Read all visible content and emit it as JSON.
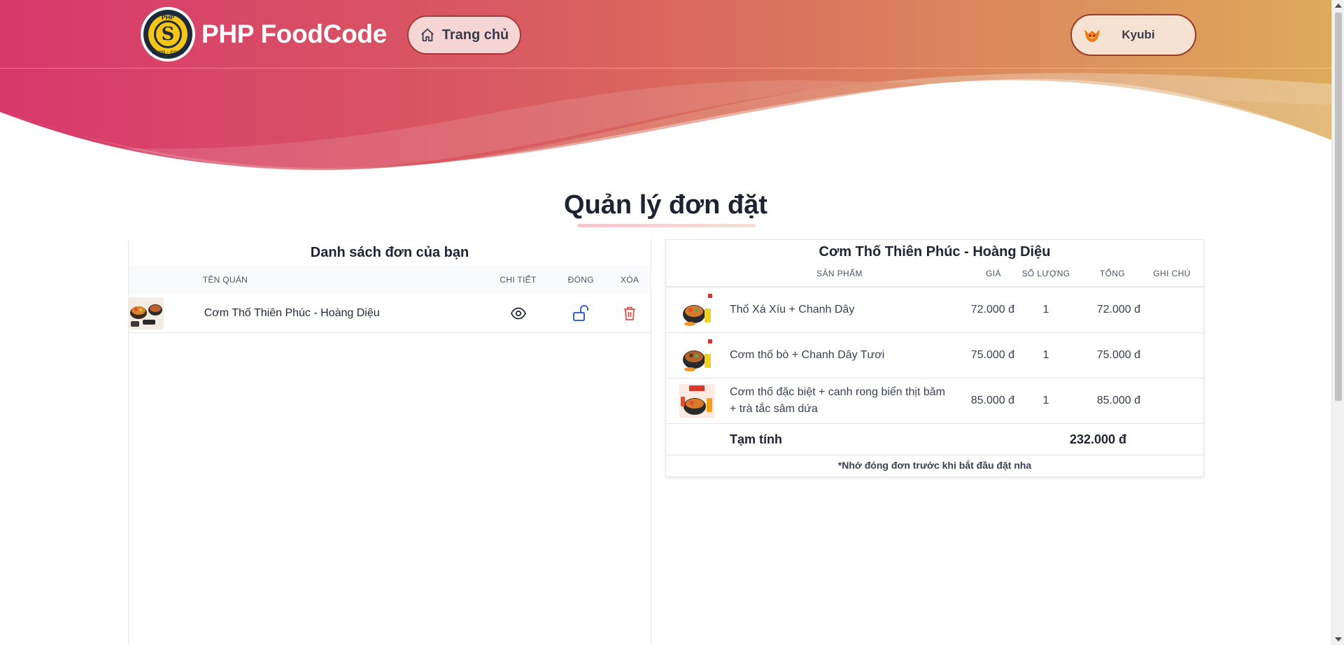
{
  "header": {
    "brand": "PHP FoodCode",
    "logo_top_text": "PHP",
    "logo_bottom_text": "FOOD · CODE",
    "home_label": "Trang chủ",
    "user_name": "Kyubi"
  },
  "page": {
    "title": "Quản lý đơn đặt"
  },
  "orders": {
    "title": "Danh sách đơn của bạn",
    "columns": {
      "name": "TÊN QUÁN",
      "detail": "CHI TIẾT",
      "close": "ĐÓNG",
      "delete": "XÓA"
    },
    "rows": [
      {
        "name": "Cơm Thố Thiên Phúc - Hoàng Diệu"
      }
    ]
  },
  "detail": {
    "title": "Cơm Thố Thiên Phúc - Hoàng Diệu",
    "columns": {
      "product": "SẢN PHẨM",
      "price": "GIÁ",
      "qty": "SỐ LƯỢNG",
      "total": "TỔNG",
      "note": "GHI CHÚ"
    },
    "items": [
      {
        "name": "Thố Xá Xíu + Chanh Dây",
        "price": "72.000 đ",
        "qty": "1",
        "total": "72.000 đ",
        "note": ""
      },
      {
        "name": "Cơm thố bò + Chanh Dây Tươi",
        "price": "75.000 đ",
        "qty": "1",
        "total": "75.000 đ",
        "note": ""
      },
      {
        "name": "Cơm thố đặc biệt + canh rong biển thịt băm + trà tắc sâm dứa",
        "price": "85.000 đ",
        "qty": "1",
        "total": "85.000 đ",
        "note": ""
      }
    ],
    "subtotal_label": "Tạm tính",
    "subtotal_value": "232.000 đ",
    "reminder": "*Nhớ đóng đơn trước khi bắt đầu đặt nha"
  },
  "colors": {
    "header_left": "#d63d6f",
    "header_mid": "#d96a5c",
    "header_right": "#ddb060",
    "delete_red": "#e04848",
    "lock_blue": "#1d4ed8"
  },
  "icons": {
    "home": "home-icon",
    "avatar": "fox-avatar-icon",
    "detail": "eye-icon",
    "close": "unlock-icon",
    "delete": "trash-icon"
  }
}
